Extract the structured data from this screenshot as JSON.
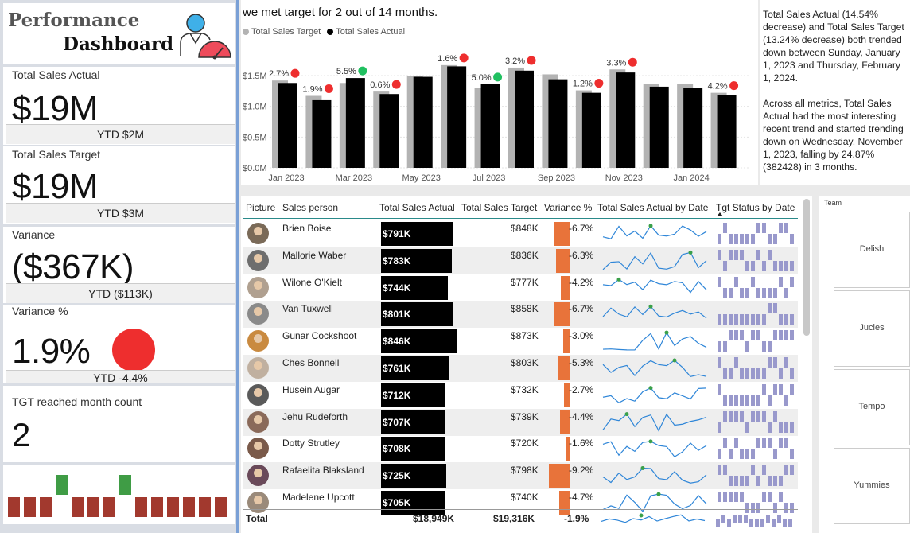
{
  "logo": {
    "line1": "Performance",
    "line2": "Dashboard"
  },
  "kpis": {
    "sales_actual": {
      "title": "Total Sales Actual",
      "value": "$19M",
      "ytd": "YTD $2M"
    },
    "sales_target": {
      "title": "Total Sales Target",
      "value": "$19M",
      "ytd": "YTD $3M"
    },
    "variance": {
      "title": "Variance",
      "value": "($367K)",
      "ytd": "YTD ($113K)"
    },
    "variance_pct": {
      "title": "Variance %",
      "value": "1.9%",
      "ytd": "YTD -4.4%",
      "status_color": "#ee2e2e"
    },
    "tgt_count": {
      "title": "TGT reached month count",
      "value": "2"
    }
  },
  "month_indicator": {
    "reached": [
      false,
      false,
      false,
      true,
      false,
      false,
      false,
      true,
      false,
      false,
      false,
      false,
      false,
      false
    ],
    "colors": {
      "hit": "#3f9c45",
      "miss": "#a2392e"
    }
  },
  "headline": "we met target for 2 out of 14 months.",
  "chart_data": {
    "type": "bar",
    "categories": [
      "Jan 2023",
      "Feb 2023",
      "Mar 2023",
      "Apr 2023",
      "May 2023",
      "Jun 2023",
      "Jul 2023",
      "Aug 2023",
      "Sep 2023",
      "Oct 2023",
      "Nov 2023",
      "Dec 2023",
      "Jan 2024",
      "Feb 2024"
    ],
    "tick_labels": [
      "Jan 2023",
      "Mar 2023",
      "May 2023",
      "Jul 2023",
      "Sep 2023",
      "Nov 2023",
      "Jan 2024"
    ],
    "series": [
      {
        "name": "Total Sales Target",
        "color": "#b3b3b3",
        "values": [
          1.42,
          1.17,
          1.38,
          1.24,
          1.5,
          1.67,
          1.3,
          1.63,
          1.52,
          1.26,
          1.6,
          1.36,
          1.37,
          1.22
        ]
      },
      {
        "name": "Total Sales Actual",
        "color": "#000000",
        "values": [
          1.38,
          1.1,
          1.46,
          1.2,
          1.48,
          1.65,
          1.36,
          1.58,
          1.44,
          1.22,
          1.55,
          1.32,
          1.3,
          1.18
        ]
      }
    ],
    "variance_labels": [
      "2.7%",
      "1.9%",
      "5.5%",
      "0.6%",
      "",
      "1.6%",
      "5.0%",
      "3.2%",
      "",
      "1.2%",
      "3.3%",
      "",
      "",
      "4.2%"
    ],
    "variance_status": [
      "miss",
      "miss",
      "hit",
      "miss",
      "",
      "miss",
      "hit",
      "miss",
      "",
      "miss",
      "miss",
      "",
      "",
      "miss"
    ],
    "status_colors": {
      "hit": "#20c060",
      "miss": "#ee2e2e"
    },
    "y_ticks": [
      "$0.0M",
      "$0.5M",
      "$1.0M",
      "$1.5M"
    ],
    "ylim": [
      0,
      1.8
    ]
  },
  "narrative": {
    "p1": "Total Sales Actual (14.54% decrease) and Total Sales Target (13.24% decrease) both trended down between Sunday, January 1, 2023 and Thursday, February 1, 2024.",
    "p2": "Across all metrics, Total Sales Actual had the most interesting recent trend and started trending down on Wednesday, November 1, 2023, falling by 24.87% (382428) in 3 months."
  },
  "table": {
    "headers": {
      "picture": "Picture",
      "sales_person": "Sales person",
      "actual": "Total Sales Actual",
      "target": "Total Sales Target",
      "variance": "Variance %",
      "by_date": "Total Sales Actual by Date",
      "status": "Tgt Status by Date"
    },
    "rows": [
      {
        "name": "Brien Boise",
        "actual": "$791K",
        "actual_num": 791,
        "target": "$848K",
        "variance": "-6.7%",
        "var_num": -6.7
      },
      {
        "name": "Mallorie Waber",
        "actual": "$783K",
        "actual_num": 783,
        "target": "$836K",
        "variance": "-6.3%",
        "var_num": -6.3
      },
      {
        "name": "Wilone O'Kielt",
        "actual": "$744K",
        "actual_num": 744,
        "target": "$777K",
        "variance": "-4.2%",
        "var_num": -4.2
      },
      {
        "name": "Van Tuxwell",
        "actual": "$801K",
        "actual_num": 801,
        "target": "$858K",
        "variance": "-6.7%",
        "var_num": -6.7
      },
      {
        "name": "Gunar Cockshoot",
        "actual": "$846K",
        "actual_num": 846,
        "target": "$873K",
        "variance": "-3.0%",
        "var_num": -3.0
      },
      {
        "name": "Ches Bonnell",
        "actual": "$761K",
        "actual_num": 761,
        "target": "$803K",
        "variance": "-5.3%",
        "var_num": -5.3
      },
      {
        "name": "Husein Augar",
        "actual": "$712K",
        "actual_num": 712,
        "target": "$732K",
        "variance": "-2.7%",
        "var_num": -2.7
      },
      {
        "name": "Jehu Rudeforth",
        "actual": "$707K",
        "actual_num": 707,
        "target": "$739K",
        "variance": "-4.4%",
        "var_num": -4.4
      },
      {
        "name": "Dotty Strutley",
        "actual": "$708K",
        "actual_num": 708,
        "target": "$720K",
        "variance": "-1.6%",
        "var_num": -1.6
      },
      {
        "name": "Rafaelita Blaksland",
        "actual": "$725K",
        "actual_num": 725,
        "target": "$798K",
        "variance": "-9.2%",
        "var_num": -9.2
      },
      {
        "name": "Madelene Upcott",
        "actual": "$705K",
        "actual_num": 705,
        "target": "$740K",
        "variance": "-4.7%",
        "var_num": -4.7
      }
    ],
    "total": {
      "label": "Total",
      "actual": "$18,949K",
      "target": "$19,316K",
      "variance": "-1.9%"
    }
  },
  "team": {
    "label": "Team",
    "items": [
      "Delish",
      "Jucies",
      "Tempo",
      "Yummies"
    ]
  },
  "colors": {
    "accent_blue": "#7aa0d6",
    "spark": "#2f86d8",
    "spark_dot": "#3aa04a",
    "status_bar": "#9999cc",
    "variance_bar": "#e8733a"
  }
}
